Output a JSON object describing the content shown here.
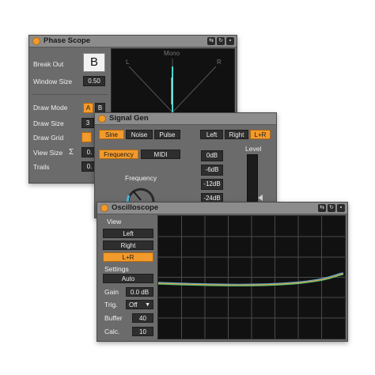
{
  "phase_scope": {
    "title": "Phase Scope",
    "break_out_label": "Break Out",
    "break_out_value": "B",
    "window_size_label": "Window Size",
    "window_size_value": "0.50",
    "draw_mode_label": "Draw Mode",
    "draw_mode_a": "A",
    "draw_mode_b": "B",
    "draw_size_label": "Draw Size",
    "draw_size_value": "3",
    "draw_grid_label": "Draw Grid",
    "view_size_label": "View Size",
    "view_size_symbol": "Σ",
    "view_size_value": "0.",
    "trails_label": "Trails",
    "trails_value": "0.",
    "scope_mono": "Mono",
    "scope_left": "L",
    "scope_right": "R"
  },
  "signal_gen": {
    "title": "Signal Gen",
    "wave_sine": "Sine",
    "wave_noise": "Noise",
    "wave_pulse": "Pulse",
    "out_left": "Left",
    "out_right": "Right",
    "out_lr": "L+R",
    "mode_frequency": "Frequency",
    "mode_midi": "MIDI",
    "frequency_label": "Frequency",
    "level_label": "Level",
    "level_buttons": [
      "0dB",
      "-6dB",
      "-12dB",
      "-24dB"
    ]
  },
  "oscilloscope": {
    "title": "Oscilloscope",
    "view_label": "View",
    "view_left": "Left",
    "view_right": "Right",
    "view_lr": "L+R",
    "settings_label": "Settings",
    "auto_label": "Auto",
    "gain_label": "Gain",
    "gain_value": "0.0 dB",
    "trig_label": "Trig.",
    "trig_value": "Off",
    "buffer_label": "Buffer",
    "buffer_value": "40",
    "calc_label": "Calc.",
    "calc_value": "10"
  },
  "icons": {
    "title_buttons": [
      "link-icon",
      "refresh-icon",
      "save-icon"
    ]
  },
  "colors": {
    "accent": "#f39a2c",
    "trace_green": "#5fc47a",
    "trace_orange": "#e89a3a",
    "trace_blue": "#58a8d8",
    "scope_needle": "#49d6d0"
  }
}
